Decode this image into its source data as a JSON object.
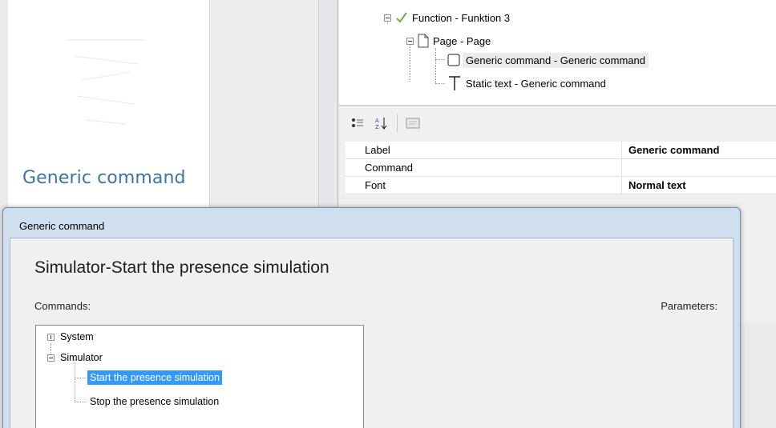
{
  "preview": {
    "title": "Generic command"
  },
  "tree": {
    "items": [
      {
        "label": "Function - Funktion 3",
        "icon": "checkmark-icon"
      },
      {
        "label": "Page - Page",
        "icon": "page-icon"
      },
      {
        "label": "Generic command - Generic command",
        "icon": "square-icon"
      },
      {
        "label": "Static text - Generic command",
        "icon": "text-T-icon"
      }
    ]
  },
  "props": {
    "toolbar": {
      "categorized_icon": "categorized-icon",
      "sort_icon": "sort-az-icon",
      "pages_icon": "property-pages-icon"
    },
    "rows": [
      {
        "name": "Label",
        "value": "Generic command"
      },
      {
        "name": "Command",
        "value": ""
      },
      {
        "name": "Font",
        "value": "Normal text"
      }
    ]
  },
  "dialog": {
    "title": "Generic command",
    "heading": "Simulator-Start the presence simulation",
    "commands_label": "Commands:",
    "parameters_label": "Parameters:",
    "tree": [
      {
        "label": "System",
        "expander": "plus"
      },
      {
        "label": "Simulator",
        "expander": "minus"
      },
      {
        "label": "Start the presence simulation",
        "selected": true
      },
      {
        "label": "Stop the presence simulation",
        "selected": false
      }
    ]
  },
  "colors": {
    "accent": "#3399ff",
    "preview_title": "#3a74a8",
    "dialog_frame": "#cfdff0"
  }
}
